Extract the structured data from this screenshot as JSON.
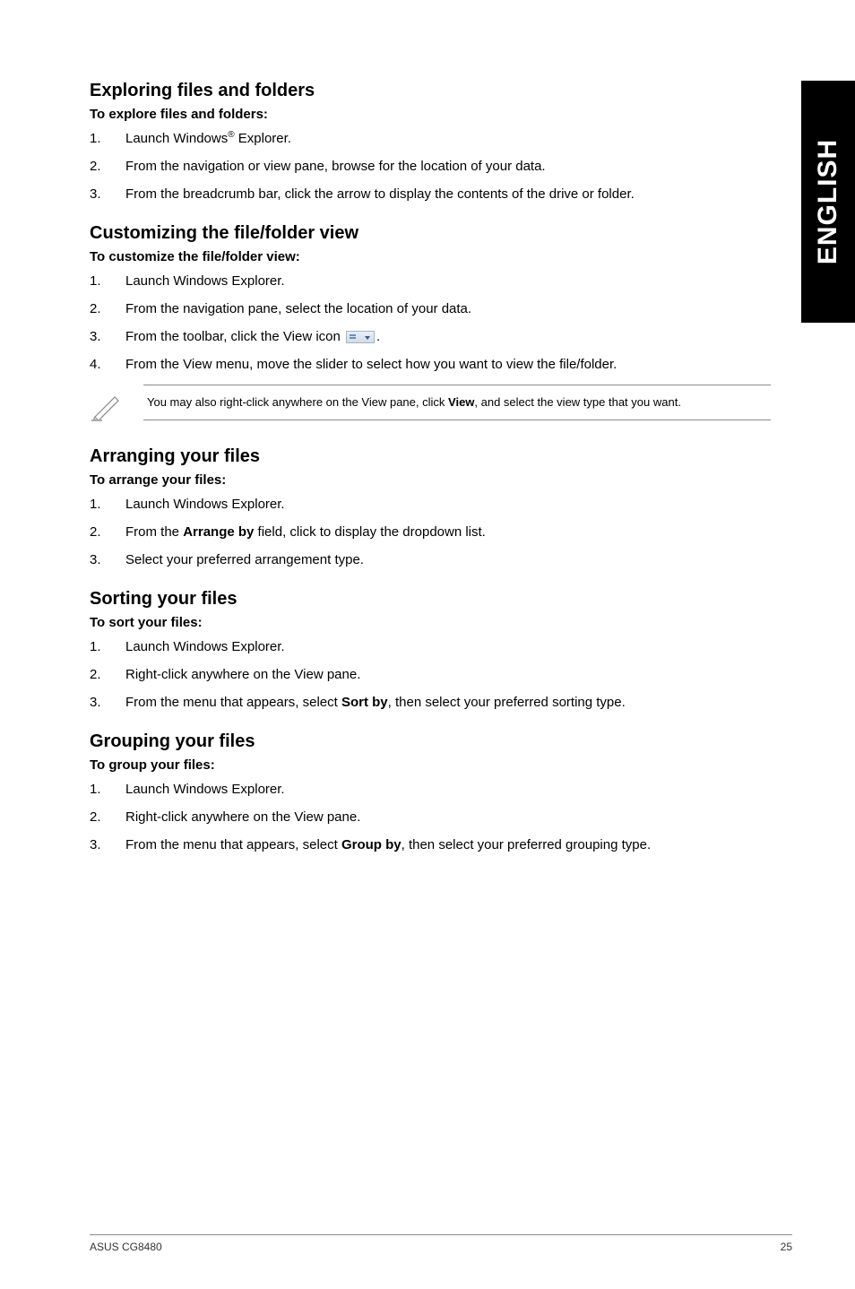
{
  "side_tab": "ENGLISH",
  "sections": {
    "exploring": {
      "title": "Exploring files and folders",
      "sub": "To explore files and folders:",
      "steps": [
        {
          "num": "1.",
          "pre": "Launch Windows",
          "sup": "®",
          "post": " Explorer."
        },
        {
          "num": "2.",
          "text": "From the navigation or view pane, browse for the location of your data."
        },
        {
          "num": "3.",
          "text": "From the breadcrumb bar, click the arrow to display the contents of the drive or folder."
        }
      ]
    },
    "customizing": {
      "title": "Customizing the file/folder view",
      "sub": "To customize the file/folder view:",
      "steps": [
        {
          "num": "1.",
          "text": "Launch Windows Explorer."
        },
        {
          "num": "2.",
          "text": "From the navigation pane, select the location of your data."
        },
        {
          "num": "3.",
          "pre": "From the toolbar, click the View icon ",
          "post": "."
        },
        {
          "num": "4.",
          "text": "From the View menu, move the slider to select how you want to view the file/folder."
        }
      ],
      "note": {
        "pre": "You may also right-click anywhere on the View pane, click ",
        "bold": "View",
        "post": ", and select the view type that you want."
      }
    },
    "arranging": {
      "title": "Arranging your files",
      "sub": "To arrange your files:",
      "steps": [
        {
          "num": "1.",
          "text": "Launch Windows Explorer."
        },
        {
          "num": "2.",
          "pre": "From the ",
          "bold": "Arrange by",
          "post": " field, click to display the dropdown list."
        },
        {
          "num": "3.",
          "text": "Select your preferred arrangement type."
        }
      ]
    },
    "sorting": {
      "title": "Sorting your files",
      "sub": "To sort your files:",
      "steps": [
        {
          "num": "1.",
          "text": "Launch Windows Explorer."
        },
        {
          "num": "2.",
          "text": "Right-click anywhere on the View pane."
        },
        {
          "num": "3.",
          "pre": "From the menu that appears, select ",
          "bold": "Sort by",
          "post": ", then select your preferred sorting type."
        }
      ]
    },
    "grouping": {
      "title": "Grouping your files",
      "sub": "To group your files:",
      "steps": [
        {
          "num": "1.",
          "text": "Launch Windows Explorer."
        },
        {
          "num": "2.",
          "text": "Right-click anywhere on the View pane."
        },
        {
          "num": "3.",
          "pre": "From the menu that appears, select ",
          "bold": "Group by",
          "post": ", then select your preferred grouping type."
        }
      ]
    }
  },
  "footer": {
    "left": "ASUS CG8480",
    "right": "25"
  }
}
